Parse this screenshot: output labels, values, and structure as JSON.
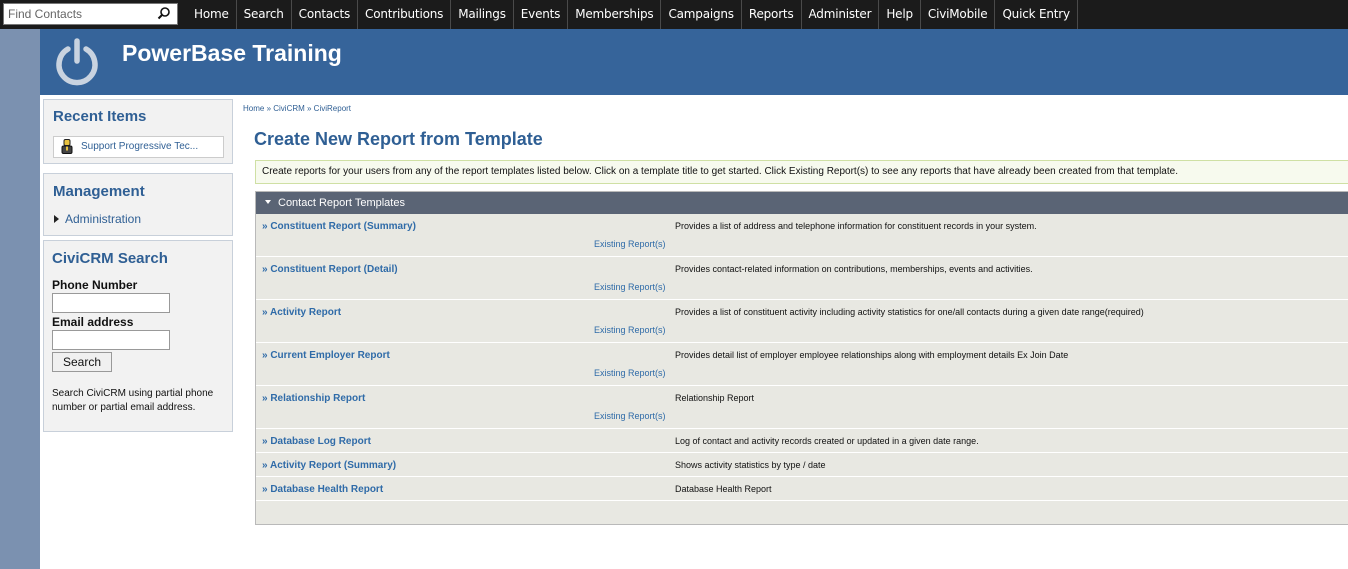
{
  "topbar": {
    "search_placeholder": "Find Contacts",
    "search_icon": "magnifier-icon",
    "menu": [
      "Home",
      "Search",
      "Contacts",
      "Contributions",
      "Mailings",
      "Events",
      "Memberships",
      "Campaigns",
      "Reports",
      "Administer",
      "Help",
      "CiviMobile",
      "Quick Entry"
    ]
  },
  "header": {
    "site_name": "PowerBase Training",
    "logo_icon": "power-icon"
  },
  "sidebar": {
    "recent": {
      "title": "Recent Items",
      "item_icon": "person-icon",
      "item": "Support Progressive Tec..."
    },
    "management": {
      "title": "Management",
      "link": "Administration"
    },
    "search": {
      "title": "CiviCRM Search",
      "phone_label": "Phone Number",
      "phone_value": "",
      "email_label": "Email address",
      "email_value": "",
      "button": "Search",
      "help": "Search CiviCRM using partial phone number or partial email address."
    }
  },
  "main": {
    "breadcrumb": "Home » CiviCRM » CiviReport",
    "title": "Create New Report from Template",
    "intro": "Create reports for your users from any of the report templates listed below. Click on a template title to get started. Click Existing Report(s) to see any reports that have already been created from that template.",
    "section_title": "Contact Report Templates",
    "reports": [
      {
        "title": "» Constituent Report (Summary)",
        "desc": "Provides a list of address and telephone information for constituent records in your system.",
        "existing": "Existing Report(s)"
      },
      {
        "title": "» Constituent Report (Detail)",
        "desc": "Provides contact-related information on contributions, memberships, events and activities.",
        "existing": "Existing Report(s)"
      },
      {
        "title": "» Activity Report",
        "desc": "Provides a list of constituent activity including activity statistics for one/all contacts during a given date range(required)",
        "existing": "Existing Report(s)"
      },
      {
        "title": "» Current Employer Report",
        "desc": "Provides detail list of employer employee relationships along with employment details Ex Join Date",
        "existing": "Existing Report(s)"
      },
      {
        "title": "» Relationship Report",
        "desc": "Relationship Report",
        "existing": "Existing Report(s)"
      },
      {
        "title": "» Database Log Report",
        "desc": "Log of contact and activity records created or updated in a given date range.",
        "existing": ""
      },
      {
        "title": "» Activity Report (Summary)",
        "desc": "Shows activity statistics by type / date",
        "existing": ""
      },
      {
        "title": "» Database Health Report",
        "desc": "Database Health Report",
        "existing": ""
      }
    ]
  }
}
